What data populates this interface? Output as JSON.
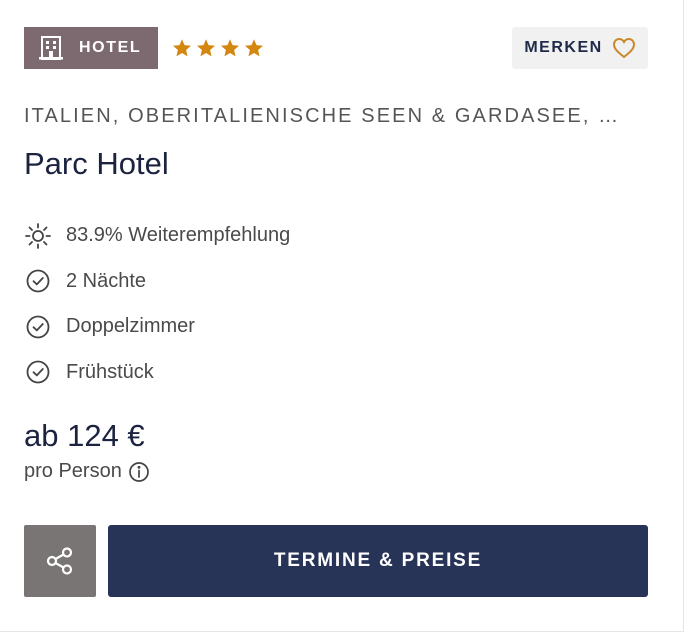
{
  "badge": {
    "label": "HOTEL",
    "icon": "hotel-building-icon",
    "background": "#7d6a70"
  },
  "rating": {
    "stars": 4,
    "icon": "star-icon",
    "color": "#d4870f"
  },
  "bookmark": {
    "label": "MERKEN",
    "icon": "heart-outline-icon",
    "icon_color": "#c8892b"
  },
  "location": "ITALIEN, OBERITALIENISCHE SEEN & GARDASEE, …",
  "hotel_name": "Parc Hotel",
  "features": [
    {
      "icon": "sun-icon",
      "text": "83.9% Weiterempfehlung"
    },
    {
      "icon": "check-circle-icon",
      "text": "2 Nächte"
    },
    {
      "icon": "check-circle-icon",
      "text": "Doppelzimmer"
    },
    {
      "icon": "check-circle-icon",
      "text": "Frühstück"
    }
  ],
  "price": {
    "text": "ab 124 €",
    "per": "pro Person",
    "info_icon": "info-icon"
  },
  "actions": {
    "share_icon": "share-icon",
    "cta_label": "TERMINE & PREISE",
    "cta_color": "#283358"
  }
}
